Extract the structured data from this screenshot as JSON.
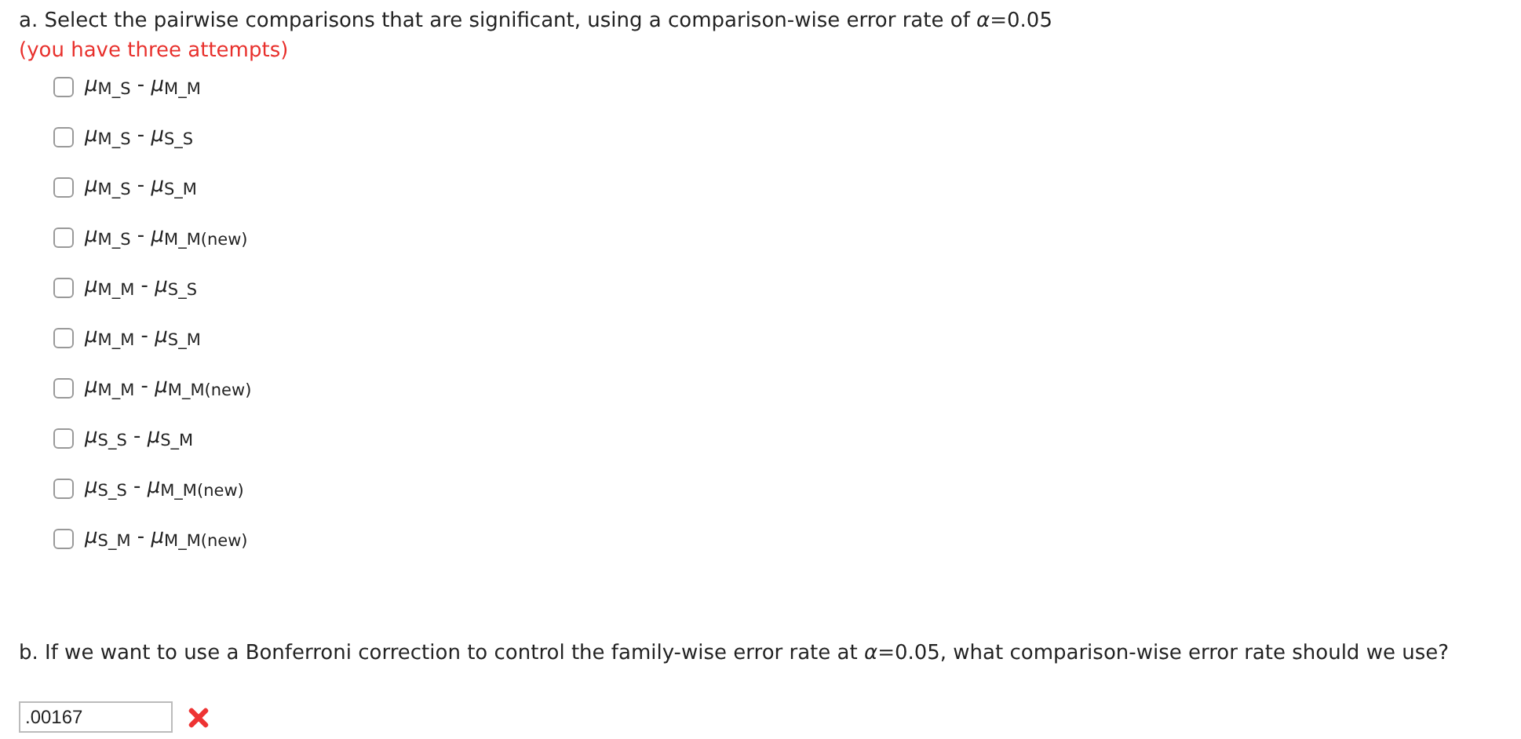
{
  "part_a": {
    "question": "a. Select the pairwise comparisons that are significant, using a comparison-wise error rate of *α*=0.05",
    "note": "(you have three attempts)",
    "options": [
      {
        "label": "*μ*$_{M_S}$ - *μ*$_{M_M}$",
        "checked": false
      },
      {
        "label": "*μ*$_{M_S}$ - *μ*$_{S_S}$",
        "checked": false
      },
      {
        "label": "*μ*$_{M_S}$ - *μ*$_{S_M}$",
        "checked": false
      },
      {
        "label": "*μ*$_{M_S}$ - *μ*$_{M_M(new)}$",
        "checked": false
      },
      {
        "label": "*μ*$_{M_M}$ - *μ*$_{S_S}$",
        "checked": false
      },
      {
        "label": "*μ*$_{M_M}$ - *μ*$_{S_M}$",
        "checked": false
      },
      {
        "label": "*μ*$_{M_M}$ - *μ*$_{M_M(new)}$",
        "checked": false
      },
      {
        "label": "*μ*$_{S_S}$ - *μ*$_{S_M}$",
        "checked": false
      },
      {
        "label": "*μ*$_{S_S}$ - *μ*$_{M_M(new)}$",
        "checked": false
      },
      {
        "label": "*μ*$_{S_M}$ - *μ*$_{M_M(new)}$",
        "checked": false
      }
    ]
  },
  "part_b": {
    "question": "b. If we want to use a Bonferroni correction to control the family-wise error rate at *α*=0.05, what comparison-wise error rate should we use?",
    "answer": ".00167",
    "correct": false
  }
}
